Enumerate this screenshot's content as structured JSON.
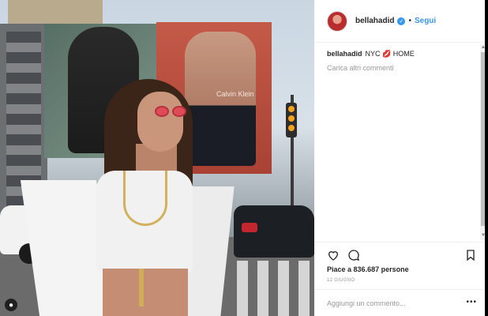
{
  "post": {
    "username": "bellahadid",
    "follow_label": "Segui",
    "caption_username": "bellahadid",
    "caption_text": "NYC 💋 HOME",
    "load_more_label": "Carica altri commenti",
    "likes_prefix": "Piace a",
    "likes_count": "836.687",
    "likes_suffix": "persone",
    "date": "12 GIUGNO",
    "comment_placeholder": "Aggiungi un commento...",
    "photo_text": "Calvin Klein"
  },
  "icons": {
    "verified": "verified-badge-icon",
    "like": "heart-icon",
    "comment": "comment-bubble-icon",
    "save": "bookmark-icon",
    "more": "more-options-icon",
    "user_tag": "user-tag-icon"
  },
  "colors": {
    "accent": "#3897f0",
    "text": "#262626",
    "muted": "#999999",
    "border": "#efefef"
  }
}
